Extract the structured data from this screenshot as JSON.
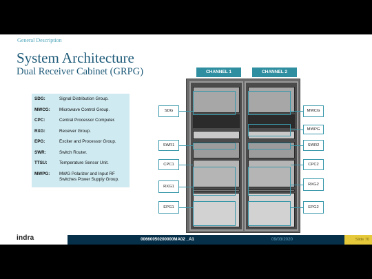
{
  "header": {
    "section": "General Description",
    "title": "System Architecture",
    "subtitle": "Dual Receiver Cabinet (GRPG)"
  },
  "legend": [
    {
      "abbr": "SDG:",
      "desc": "Signal Distribution Group."
    },
    {
      "abbr": "MWCG:",
      "desc": "Microwave Control Group."
    },
    {
      "abbr": "CPC:",
      "desc": "Central Processor Computer."
    },
    {
      "abbr": "RXG:",
      "desc": "Receiver Group."
    },
    {
      "abbr": "EPG:",
      "desc": "Exciter and Processor Group."
    },
    {
      "abbr": "SWR:",
      "desc": "Switch Router."
    },
    {
      "abbr": "TTSU:",
      "desc": "Temperature Sensor Unit."
    },
    {
      "abbr": "MWPG:",
      "desc": "MWG Polarizer and Input RF",
      "desc2": "Switches Power Supply Group."
    }
  ],
  "channels": {
    "ch1": "CHANNEL 1",
    "ch2": "CHANNEL 2"
  },
  "labels": {
    "sdg": "SDG",
    "swr1": "SWR1",
    "cpc1": "CPC1",
    "rxg1": "RXG1",
    "epg1": "EPG1",
    "mwcg": "MWCG",
    "mwpg": "MWPG",
    "swr2": "SWR2",
    "cpc2": "CPC2",
    "rxg2": "RXG2",
    "epg2": "EPG2"
  },
  "footer": {
    "logo": "indra",
    "doc_id": "00660050200000MA02 _A1",
    "date": "09/03/2020",
    "slide": "Slide 70"
  },
  "colors": {
    "accent": "#3a98ab",
    "title": "#1d5a78",
    "legend_bg": "#cfeaf1",
    "footer_bar": "#06304a",
    "slide_tab": "#e6c93a"
  }
}
